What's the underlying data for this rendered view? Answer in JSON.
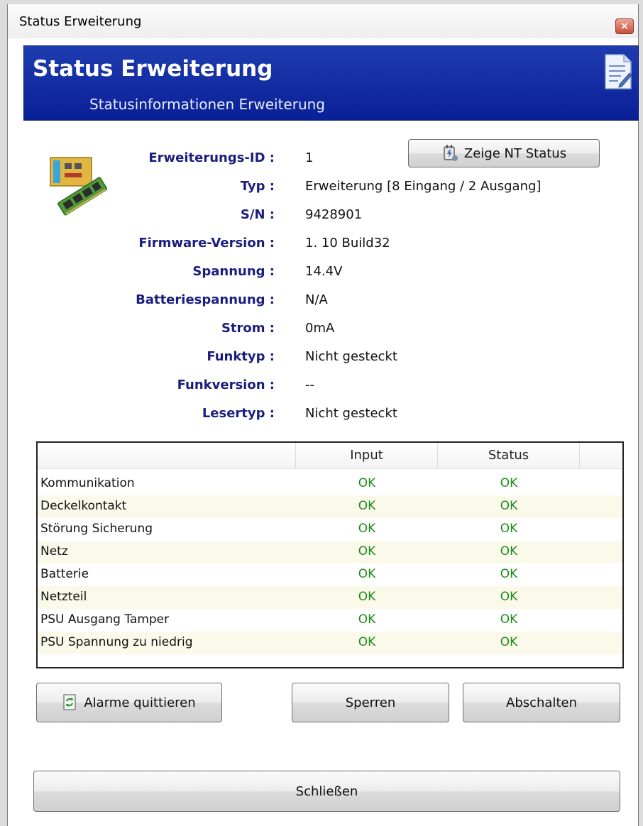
{
  "window": {
    "title": "Status Erweiterung",
    "close_glyph": "×"
  },
  "banner": {
    "title": "Status Erweiterung",
    "subtitle": "Statusinformationen Erweiterung",
    "icon": "document-edit-icon"
  },
  "details": [
    {
      "label": "Erweiterungs-ID :",
      "value": "1"
    },
    {
      "label": "Typ :",
      "value": "Erweiterung [8 Eingang / 2 Ausgang]"
    },
    {
      "label": "S/N :",
      "value": "9428901"
    },
    {
      "label": "Firmware-Version :",
      "value": "1. 10 Build32"
    },
    {
      "label": "Spannung :",
      "value": "14.4V"
    },
    {
      "label": "Batteriespannung :",
      "value": "N/A"
    },
    {
      "label": "Strom :",
      "value": "0mA"
    },
    {
      "label": "Funktyp :",
      "value": "Nicht gesteckt"
    },
    {
      "label": "Funkversion :",
      "value": "--"
    },
    {
      "label": "Lesertyp :",
      "value": "Nicht gesteckt"
    }
  ],
  "nt_button": {
    "label": "Zeige NT Status",
    "icon": "power-supply-icon"
  },
  "table": {
    "headers": [
      "",
      "Input",
      "Status"
    ],
    "rows": [
      {
        "name": "Kommunikation",
        "input": "OK",
        "status": "OK"
      },
      {
        "name": "Deckelkontakt",
        "input": "OK",
        "status": "OK"
      },
      {
        "name": "Störung Sicherung",
        "input": "OK",
        "status": "OK"
      },
      {
        "name": "Netz",
        "input": "OK",
        "status": "OK"
      },
      {
        "name": "Batterie",
        "input": "OK",
        "status": "OK"
      },
      {
        "name": "Netzteil",
        "input": "OK",
        "status": "OK"
      },
      {
        "name": "PSU Ausgang Tamper",
        "input": "OK",
        "status": "OK"
      },
      {
        "name": "PSU Spannung zu niedrig",
        "input": "OK",
        "status": "OK"
      }
    ]
  },
  "actions": {
    "acknowledge": "Alarme quittieren",
    "lock": "Sperren",
    "disable": "Abschalten",
    "close": "Schließen"
  },
  "colors": {
    "banner": "#0a1f96",
    "label": "#1a1f7e",
    "ok": "#1c8a1c"
  }
}
